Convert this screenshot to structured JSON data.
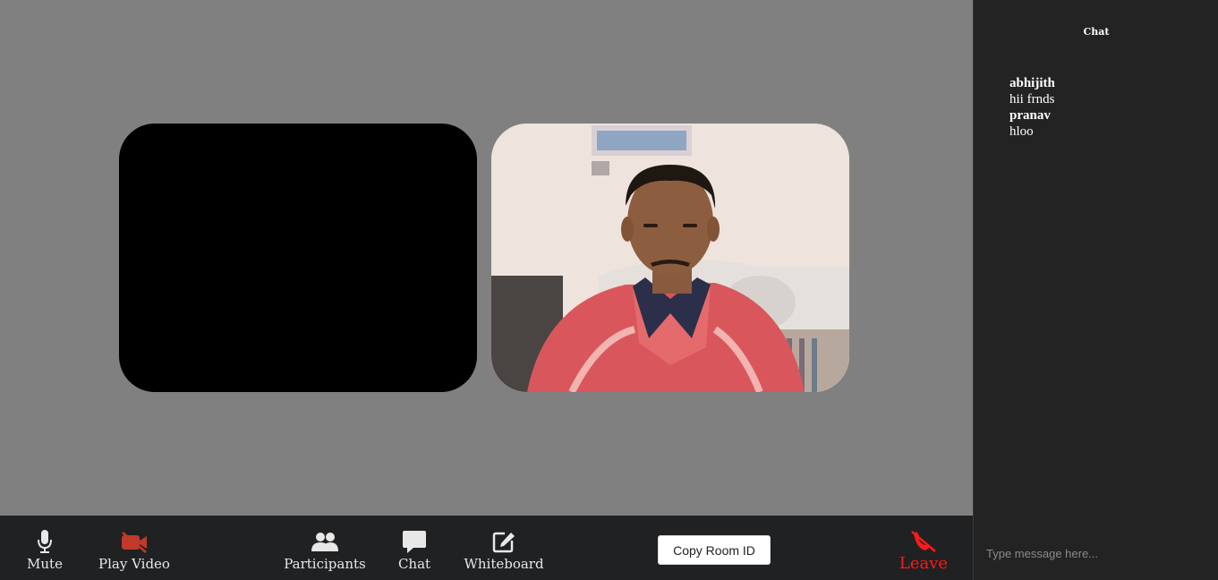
{
  "controls": {
    "mute_label": "Mute",
    "play_video_label": "Play Video",
    "participants_label": "Participants",
    "chat_label": "Chat",
    "whiteboard_label": "Whiteboard",
    "copy_room_label": "Copy Room ID",
    "leave_label": "Leave"
  },
  "icons": {
    "mute": "microphone-icon",
    "play_video": "video-slash-icon",
    "participants": "users-icon",
    "chat": "comment-icon",
    "whiteboard": "edit-icon",
    "leave": "phone-slash-icon"
  },
  "colors": {
    "video_off": "#c0392b",
    "leave": "#ff1a1a",
    "stage_bg": "#808080",
    "toolbar_bg": "#202122",
    "chat_bg": "#232323"
  },
  "chat": {
    "title": "Chat",
    "messages": [
      {
        "user": "abhijith",
        "text": "hii frnds"
      },
      {
        "user": "pranav",
        "text": "hloo"
      }
    ],
    "input_placeholder": "Type message here..."
  }
}
